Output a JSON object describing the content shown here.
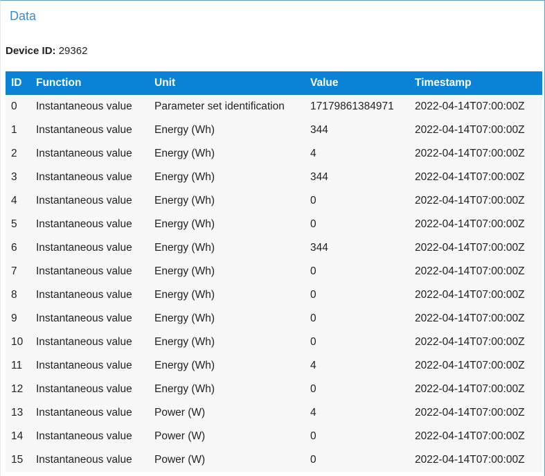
{
  "panel": {
    "title": "Data"
  },
  "device": {
    "label": "Device ID:",
    "value": "29362"
  },
  "table": {
    "headers": [
      "ID",
      "Function",
      "Unit",
      "Value",
      "Timestamp"
    ],
    "rows": [
      [
        "0",
        "Instantaneous value",
        "Parameter set identification",
        "17179861384971",
        "2022-04-14T07:00:00Z"
      ],
      [
        "1",
        "Instantaneous value",
        "Energy (Wh)",
        "344",
        "2022-04-14T07:00:00Z"
      ],
      [
        "2",
        "Instantaneous value",
        "Energy (Wh)",
        "4",
        "2022-04-14T07:00:00Z"
      ],
      [
        "3",
        "Instantaneous value",
        "Energy (Wh)",
        "344",
        "2022-04-14T07:00:00Z"
      ],
      [
        "4",
        "Instantaneous value",
        "Energy (Wh)",
        "0",
        "2022-04-14T07:00:00Z"
      ],
      [
        "5",
        "Instantaneous value",
        "Energy (Wh)",
        "0",
        "2022-04-14T07:00:00Z"
      ],
      [
        "6",
        "Instantaneous value",
        "Energy (Wh)",
        "344",
        "2022-04-14T07:00:00Z"
      ],
      [
        "7",
        "Instantaneous value",
        "Energy (Wh)",
        "0",
        "2022-04-14T07:00:00Z"
      ],
      [
        "8",
        "Instantaneous value",
        "Energy (Wh)",
        "0",
        "2022-04-14T07:00:00Z"
      ],
      [
        "9",
        "Instantaneous value",
        "Energy (Wh)",
        "0",
        "2022-04-14T07:00:00Z"
      ],
      [
        "10",
        "Instantaneous value",
        "Energy (Wh)",
        "0",
        "2022-04-14T07:00:00Z"
      ],
      [
        "11",
        "Instantaneous value",
        "Energy (Wh)",
        "4",
        "2022-04-14T07:00:00Z"
      ],
      [
        "12",
        "Instantaneous value",
        "Energy (Wh)",
        "0",
        "2022-04-14T07:00:00Z"
      ],
      [
        "13",
        "Instantaneous value",
        "Power (W)",
        "4",
        "2022-04-14T07:00:00Z"
      ],
      [
        "14",
        "Instantaneous value",
        "Power (W)",
        "0",
        "2022-04-14T07:00:00Z"
      ],
      [
        "15",
        "Instantaneous value",
        "Power (W)",
        "0",
        "2022-04-14T07:00:00Z"
      ]
    ]
  },
  "colors": {
    "header_bg": "#0a82d6",
    "title": "#3a8ad4",
    "row_bg": "#f7f7f7"
  }
}
